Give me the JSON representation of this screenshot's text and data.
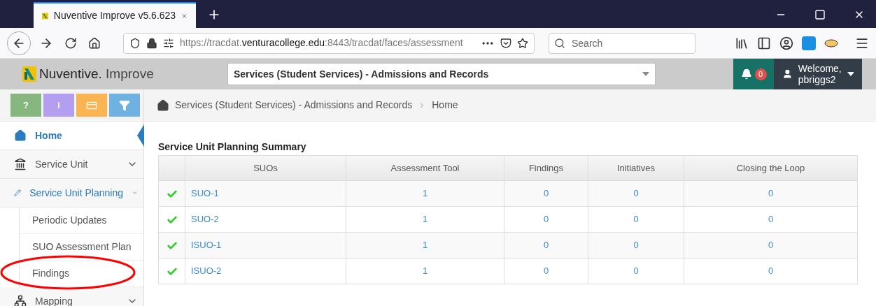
{
  "browser": {
    "tab_title": "Nuventive Improve v5.6.623",
    "url_prefix": "https://tracdat.",
    "url_domain": "venturacollege.edu",
    "url_suffix": ":8443/tracdat/faces/assessment",
    "search_placeholder": "Search"
  },
  "header": {
    "brand": "Nuventive.",
    "brand_suffix": "Improve",
    "unit_select": "Services (Student Services) - Admissions and Records",
    "notification_count": "0",
    "welcome": "Welcome,",
    "user": "pbriggs2"
  },
  "toolbar_buttons": [
    {
      "label": "?",
      "color": "#86b77e"
    },
    {
      "label": "i",
      "color": "#b39ef0"
    },
    {
      "kind": "card",
      "color": "#fbb452"
    },
    {
      "kind": "filter",
      "color": "#6fb1e0"
    }
  ],
  "sidebar": {
    "items": [
      {
        "label": "Home",
        "selected": true
      },
      {
        "label": "Service Unit",
        "selected": false,
        "expanded": false
      },
      {
        "label": "Service Unit Planning",
        "selected": false,
        "expanded": true,
        "children": [
          {
            "label": "Periodic Updates"
          },
          {
            "label": "SUO Assessment Plan"
          },
          {
            "label": "Findings"
          }
        ]
      },
      {
        "label": "Mapping",
        "selected": false,
        "expanded": false
      }
    ]
  },
  "breadcrumb": [
    "Services (Student Services) - Admissions and Records",
    "Home"
  ],
  "table": {
    "title": "Service Unit Planning Summary",
    "columns": [
      "SUOs",
      "Assessment Tool",
      "Findings",
      "Initiatives",
      "Closing the Loop"
    ],
    "rows": [
      {
        "done": true,
        "cells": [
          "SUO-1",
          "1",
          "0",
          "0",
          "0"
        ]
      },
      {
        "done": true,
        "cells": [
          "SUO-2",
          "1",
          "0",
          "0",
          "0"
        ]
      },
      {
        "done": true,
        "cells": [
          "ISUO-1",
          "1",
          "0",
          "0",
          "0"
        ]
      },
      {
        "done": true,
        "cells": [
          "ISUO-2",
          "1",
          "0",
          "0",
          "0"
        ]
      }
    ]
  }
}
